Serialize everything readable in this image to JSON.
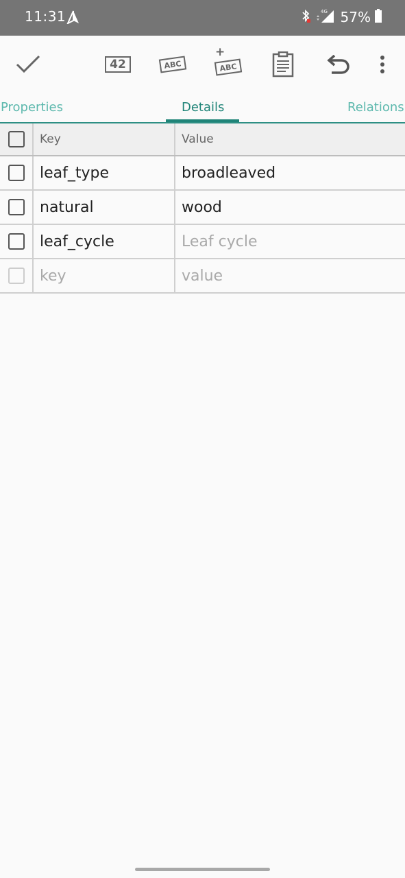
{
  "status": {
    "time": "11:31",
    "network": "4G",
    "battery": "57%"
  },
  "toolbar": {
    "confirm_icon": "check-icon",
    "number_badge": "42",
    "abc_label": "ABC",
    "add_abc_label": "ABC",
    "add_abc_plus": "+"
  },
  "tabs": [
    {
      "label": "Properties"
    },
    {
      "label": "Details"
    },
    {
      "label": "Relations"
    }
  ],
  "table": {
    "headers": {
      "key": "Key",
      "value": "Value"
    },
    "rows": [
      {
        "key": "leaf_type",
        "value": "broadleaved",
        "value_is_hint": false
      },
      {
        "key": "natural",
        "value": "wood",
        "value_is_hint": false
      },
      {
        "key": "leaf_cycle",
        "value": "Leaf cycle",
        "value_is_hint": true
      }
    ],
    "new_row": {
      "key_placeholder": "key",
      "value_placeholder": "value"
    }
  },
  "colors": {
    "accent": "#1f8478",
    "accent_light": "#5cb8ad",
    "status_bar": "#757575"
  }
}
